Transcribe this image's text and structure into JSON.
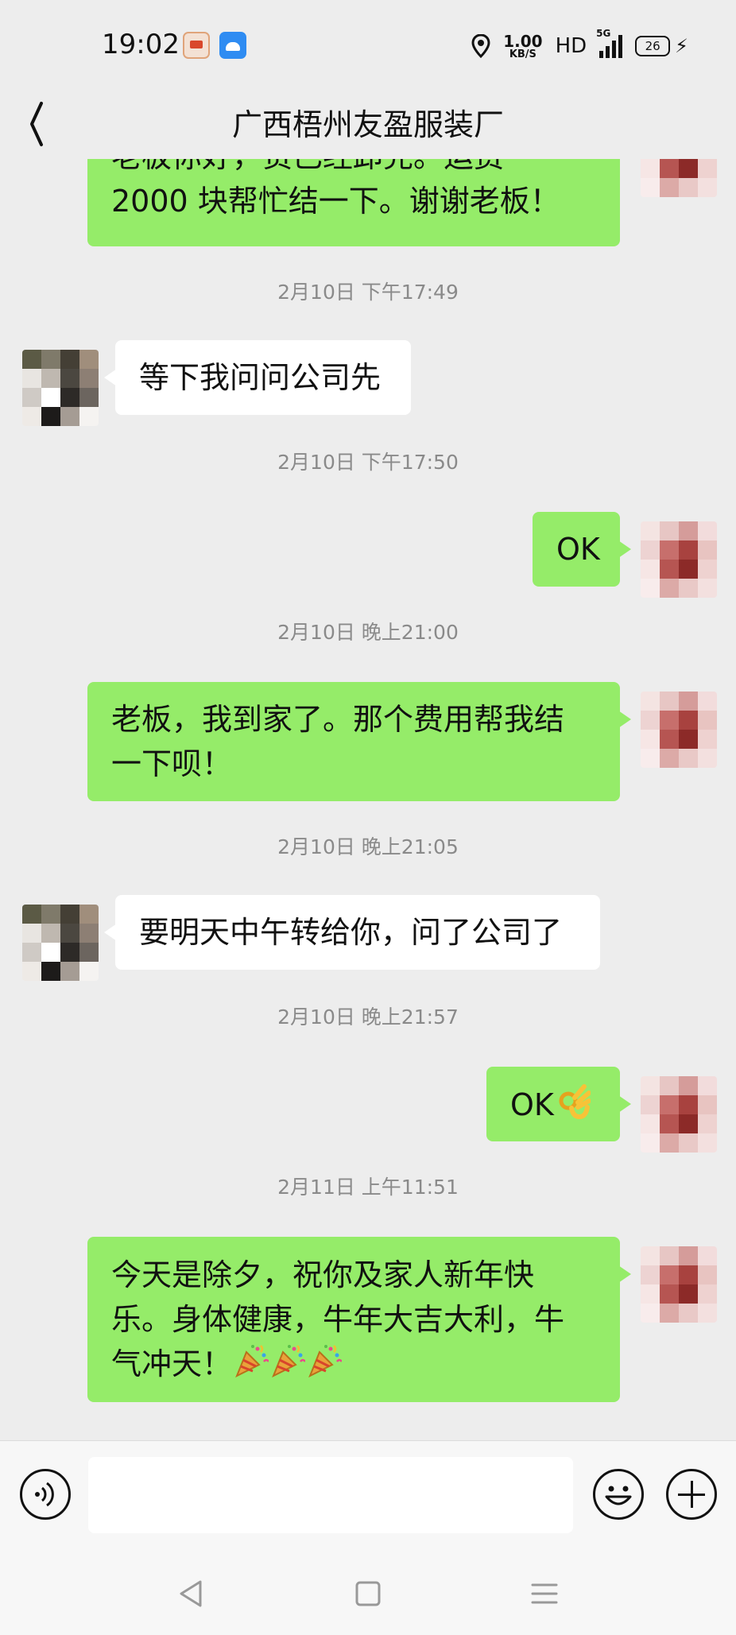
{
  "status_bar": {
    "time": "19:02",
    "speed_value": "1.00",
    "speed_unit": "KB/S",
    "hd": "HD",
    "network": "5G",
    "battery": "26"
  },
  "header": {
    "title": "广西梧州友盈服装厂"
  },
  "messages": [
    {
      "type": "msg",
      "sender": "me",
      "lines": [
        "老板你好，货已经卸完。运费",
        "2000 块帮忙结一下。谢谢老板！"
      ]
    },
    {
      "type": "time",
      "text": "2月10日 下午17:49"
    },
    {
      "type": "msg",
      "sender": "them",
      "lines": [
        "等下我问问公司先"
      ]
    },
    {
      "type": "time",
      "text": "2月10日 下午17:50"
    },
    {
      "type": "msg",
      "sender": "me",
      "lines": [
        "OK"
      ]
    },
    {
      "type": "time",
      "text": "2月10日 晚上21:00"
    },
    {
      "type": "msg",
      "sender": "me",
      "lines": [
        "老板，我到家了。那个费用帮我结",
        "一下呗！"
      ]
    },
    {
      "type": "time",
      "text": "2月10日 晚上21:05"
    },
    {
      "type": "msg",
      "sender": "them",
      "lines": [
        "要明天中午转给你，问了公司了"
      ]
    },
    {
      "type": "time",
      "text": "2月10日 晚上21:57"
    },
    {
      "type": "msg",
      "sender": "me",
      "lines": [
        "OK"
      ],
      "emoji": "ok-hand"
    },
    {
      "type": "time",
      "text": "2月11日 上午11:51"
    },
    {
      "type": "msg",
      "sender": "me",
      "lines": [
        "今天是除夕，祝你及家人新年快",
        "乐。身体健康，牛年大吉大利，牛",
        "气冲天！"
      ],
      "emoji": "party-popper"
    }
  ],
  "input": {
    "placeholder": ""
  },
  "icons": {
    "back": "chevron-left-icon",
    "voice": "voice-icon",
    "emoji": "smiley-icon",
    "plus": "plus-icon"
  },
  "colors": {
    "bubble_me": "#95ec69",
    "bubble_them": "#ffffff",
    "background": "#ededed"
  }
}
